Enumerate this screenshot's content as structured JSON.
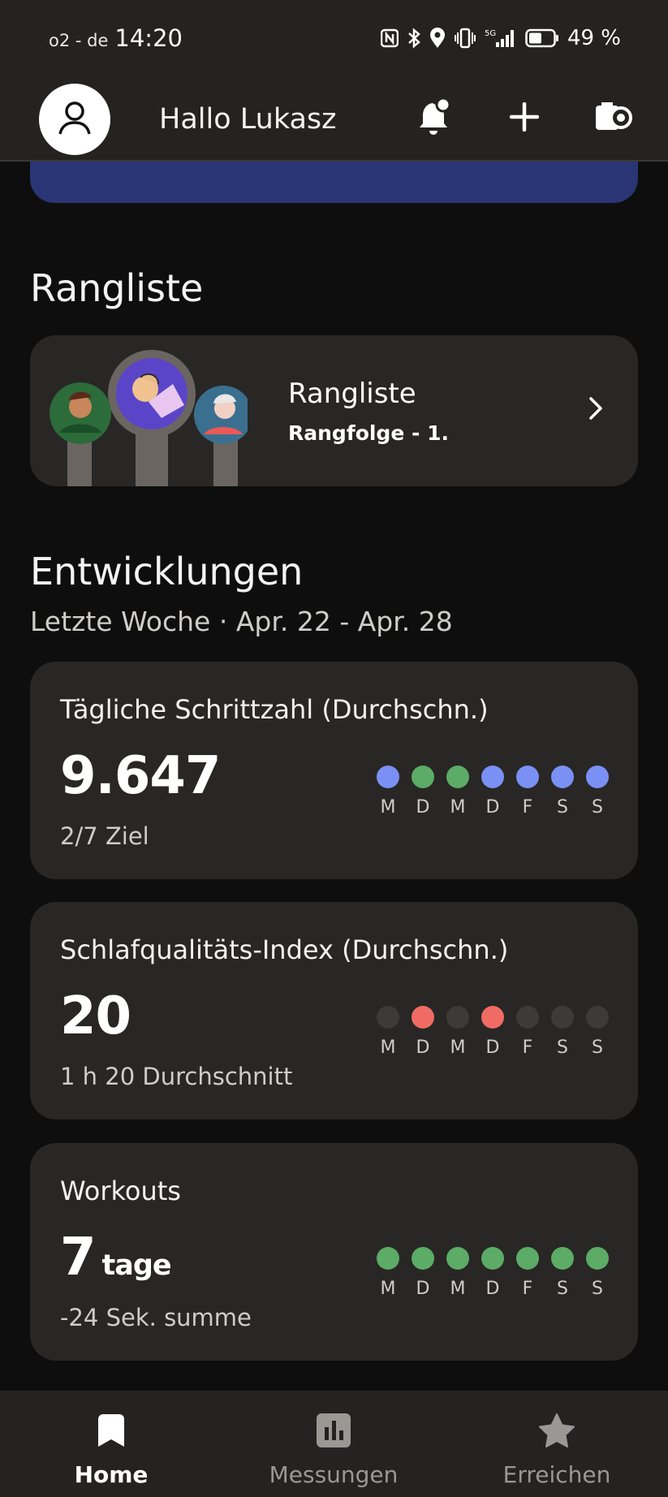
{
  "status_bar": {
    "carrier": "o2 - de",
    "time": "14:20",
    "network": "5G",
    "battery": "49 %"
  },
  "header": {
    "greeting": "Hallo Lukasz",
    "icons": [
      "user-icon",
      "bell-icon",
      "plus-icon",
      "watch-icon"
    ]
  },
  "leaderboard": {
    "section_title": "Rangliste",
    "card_title": "Rangliste",
    "card_subtitle": "Rangfolge - 1."
  },
  "trends": {
    "section_title": "Entwicklungen",
    "subtitle": "Letzte Woche · Apr. 22 - Apr. 28",
    "day_labels": [
      "M",
      "D",
      "M",
      "D",
      "F",
      "S",
      "S"
    ],
    "cards": [
      {
        "title": "Tägliche Schrittzahl (Durchschn.)",
        "value": "9.647",
        "unit": "",
        "note": "2/7 Ziel",
        "dots": [
          "#7a90f5",
          "#5cab66",
          "#5cab66",
          "#7a90f5",
          "#7a90f5",
          "#7a90f5",
          "#7a90f5"
        ]
      },
      {
        "title": "Schlafqualitäts-Index (Durchschn.)",
        "value": "20",
        "unit": "",
        "note": "1 h 20 Durchschnitt",
        "dots": [
          "#3d3b39",
          "#f06b63",
          "#3d3b39",
          "#f06b63",
          "#3d3b39",
          "#3d3b39",
          "#3d3b39"
        ]
      },
      {
        "title": "Workouts",
        "value": "7",
        "unit": "tage",
        "note": "-24 Sek. summe",
        "dots": [
          "#5cab66",
          "#5cab66",
          "#5cab66",
          "#5cab66",
          "#5cab66",
          "#5cab66",
          "#5cab66"
        ]
      }
    ]
  },
  "bottom_nav": {
    "items": [
      {
        "label": "Home",
        "icon": "bookmark-icon",
        "active": true
      },
      {
        "label": "Messungen",
        "icon": "bar-chart-icon",
        "active": false
      },
      {
        "label": "Erreichen",
        "icon": "star-icon",
        "active": false
      }
    ]
  },
  "colors": {
    "background": "#0e0e0e",
    "bar": "#242321",
    "card": "#282725",
    "banner": "#2a3575",
    "steps_blue": "#7a90f5",
    "goal_green": "#5cab66",
    "sleep_red": "#f06b63",
    "inactive_dot": "#3d3b39"
  }
}
